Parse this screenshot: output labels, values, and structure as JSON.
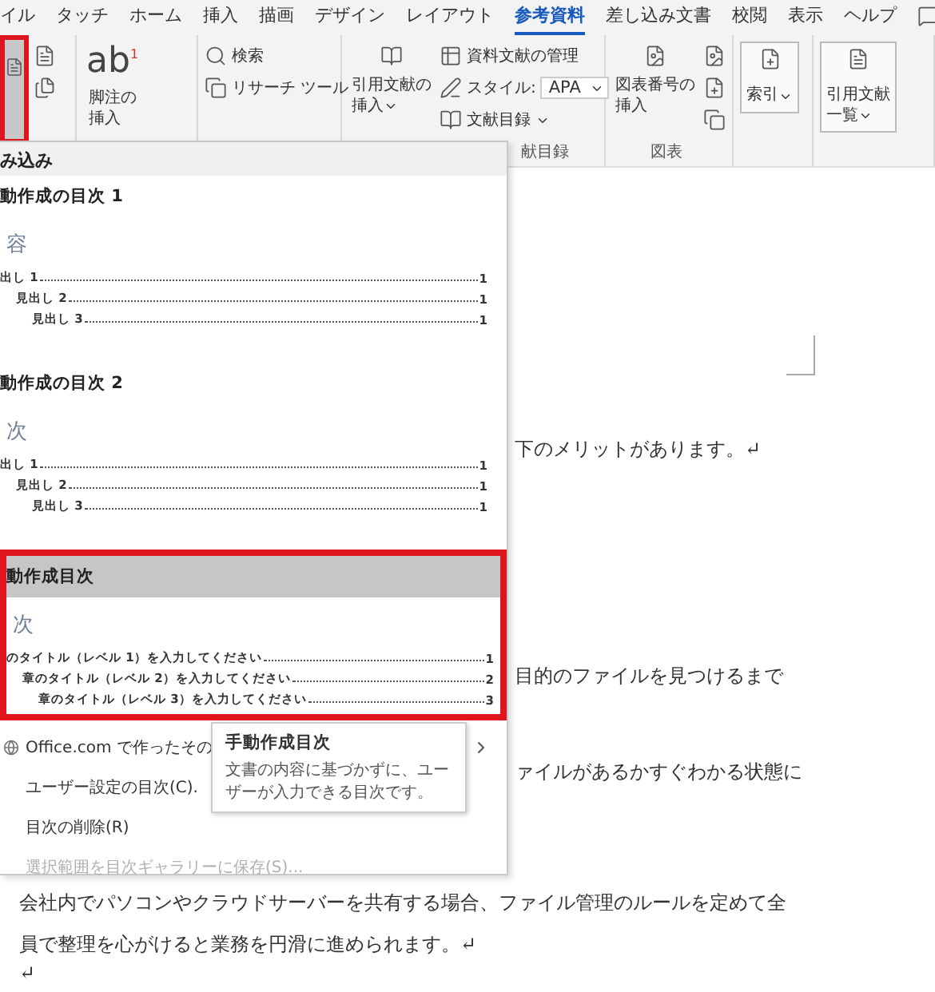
{
  "tabs": [
    {
      "label": "イル",
      "selected": false
    },
    {
      "label": "タッチ",
      "selected": false
    },
    {
      "label": "ホーム",
      "selected": false
    },
    {
      "label": "挿入",
      "selected": false
    },
    {
      "label": "描画",
      "selected": false
    },
    {
      "label": "デザイン",
      "selected": false
    },
    {
      "label": "レイアウト",
      "selected": false
    },
    {
      "label": "参考資料",
      "selected": true
    },
    {
      "label": "差し込み文書",
      "selected": false
    },
    {
      "label": "校閲",
      "selected": false
    },
    {
      "label": "表示",
      "selected": false
    },
    {
      "label": "ヘルプ",
      "selected": false
    }
  ],
  "ribbon": {
    "groups": [
      {
        "items": [
          {
            "kind": "toc"
          },
          {
            "kind": "icons"
          }
        ]
      },
      {
        "items": [
          {
            "kind": "large",
            "label": [
              "脚注の",
              "挿入"
            ],
            "glyph": "ab",
            "sup": "1",
            "caret": false
          },
          {
            "kind": "icons"
          }
        ]
      },
      {
        "items": [
          {
            "kind": "list",
            "entries": [
              "検索",
              "リサーチ ツール"
            ]
          }
        ]
      },
      {
        "label": "献目録",
        "items": [
          {
            "kind": "large",
            "label": [
              "引用文献の",
              "挿入"
            ],
            "caret": true
          },
          {
            "kind": "list",
            "entries": [
              "資料文献の管理"
            ],
            "select": {
              "label": "スタイル:",
              "value": "APA"
            },
            "dropdown": "文献目録"
          }
        ]
      },
      {
        "label": "図表",
        "items": [
          {
            "kind": "large",
            "label": [
              "図表番号の",
              "挿入"
            ],
            "caret": false
          },
          {
            "kind": "icons"
          }
        ]
      },
      {
        "items": [
          {
            "kind": "large",
            "label": [
              "索引"
            ],
            "caret": true
          }
        ]
      },
      {
        "items": [
          {
            "kind": "large",
            "label": [
              "引用文献",
              "一覧"
            ],
            "caret": true
          }
        ]
      }
    ]
  },
  "toc_menu": {
    "section": "み込み",
    "gallery": [
      {
        "title": "動作成の目次 1",
        "selected": false,
        "framed": false,
        "preview_title": "容",
        "entries": [
          {
            "label": "出し 1",
            "page": "1",
            "children": [
              {
                "label": "見出し 2",
                "page": "1",
                "children": [
                  {
                    "label": "見出し 3",
                    "page": "1"
                  }
                ]
              }
            ]
          }
        ]
      },
      {
        "title": "動作成の目次 2",
        "selected": false,
        "framed": false,
        "preview_title": "次",
        "entries": [
          {
            "label": "出し 1",
            "page": "1",
            "children": [
              {
                "label": "見出し 2",
                "page": "1",
                "children": [
                  {
                    "label": "見出し 3",
                    "page": "1"
                  }
                ]
              }
            ]
          }
        ]
      },
      {
        "title": "動作成目次",
        "selected": true,
        "framed": true,
        "preview_title": "次",
        "entries": [
          {
            "label": "のタイトル（レベル 1）を入力してください",
            "page": "1",
            "children": [
              {
                "label": "章のタイトル（レベル 2）を入力してください",
                "page": "2",
                "children": [
                  {
                    "label": "章のタイトル（レベル 3）を入力してください",
                    "page": "3"
                  }
                ]
              }
            ]
          }
        ]
      }
    ],
    "commands": [
      {
        "label": "Office.com で作ったその",
        "kind": "link",
        "disabled": false,
        "submenu": true
      },
      {
        "label": "ユーザー設定の目次(C).",
        "kind": "plain",
        "disabled": false,
        "submenu": false
      },
      {
        "label": "目次の削除(R)",
        "kind": "plain",
        "disabled": false,
        "submenu": false
      },
      {
        "label": "選択範囲を目次ギャラリーに保存(S)...",
        "kind": "plain",
        "disabled": true,
        "submenu": false
      }
    ],
    "tooltip": {
      "title": "手動作成目次",
      "text": "文書の内容に基づかずに、ユーザーが入力できる目次です。"
    }
  },
  "document": {
    "paragraphs": [
      {
        "kind": "partial",
        "text": "下のメリットがあります。↵"
      },
      {
        "kind": "partial",
        "text": "目的のファイルを見つけるまで"
      },
      {
        "kind": "partial",
        "text": "ァイルがあるかすぐわかる状態に"
      },
      {
        "kind": "full",
        "text": "会社内でパソコンやクラウドサーバーを共有する場合、ファイル管理のルールを定めて全員で整理を心がけると業務を円滑に進められます。↵"
      },
      {
        "kind": "full",
        "text": "↵"
      }
    ]
  }
}
